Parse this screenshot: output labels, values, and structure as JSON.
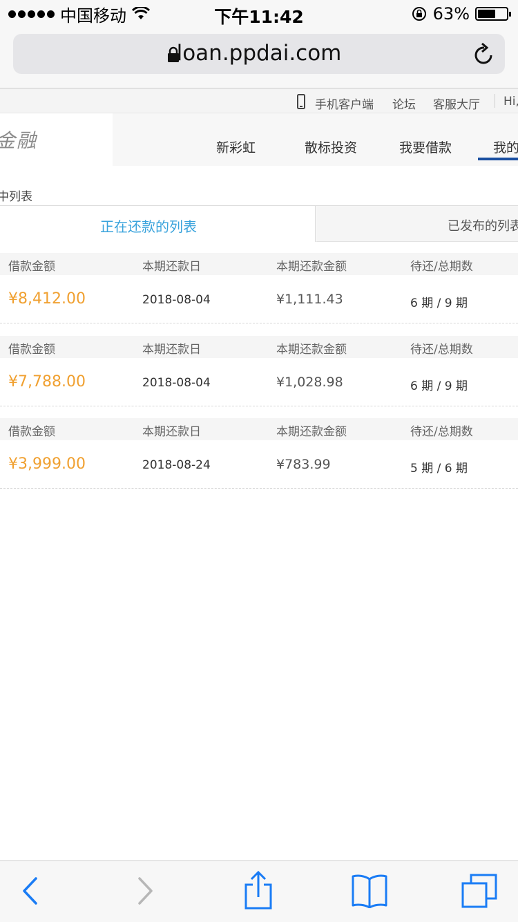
{
  "status_bar": {
    "carrier": "中国移动",
    "time": "下午11:42",
    "battery_percent": "63%",
    "battery_level": 0.63
  },
  "browser": {
    "url": "loan.ppdai.com"
  },
  "top_links": {
    "mobile_client": "手机客户端",
    "forum": "论坛",
    "service_hall": "客服大厅",
    "greeting": "Hi,"
  },
  "header": {
    "logo_text": "金融",
    "nav": [
      "新彩虹",
      "散标投资",
      "我要借款",
      "我的"
    ]
  },
  "section_title": "中列表",
  "tabs": {
    "active": "正在还款的列表",
    "inactive": "已发布的列表"
  },
  "loan_columns": {
    "amount": "借款金额",
    "due_date": "本期还款日",
    "due_amount": "本期还款金额",
    "periods": "待还/总期数"
  },
  "loans": [
    {
      "amount": "¥8,412.00",
      "due_date": "2018-08-04",
      "due_amount": "¥1,111.43",
      "periods": "6 期 / 9 期"
    },
    {
      "amount": "¥7,788.00",
      "due_date": "2018-08-04",
      "due_amount": "¥1,028.98",
      "periods": "6 期 / 9 期"
    },
    {
      "amount": "¥3,999.00",
      "due_date": "2018-08-24",
      "due_amount": "¥783.99",
      "periods": "5 期 / 6 期"
    }
  ],
  "toolbar_icons": [
    "back-icon",
    "forward-icon",
    "share-icon",
    "bookmarks-icon",
    "tabs-icon"
  ],
  "colors": {
    "accent_blue": "#3aa3dc",
    "nav_underline": "#1a4fa0",
    "amount_orange": "#f0a030",
    "ios_blue": "#1a7cf5"
  }
}
